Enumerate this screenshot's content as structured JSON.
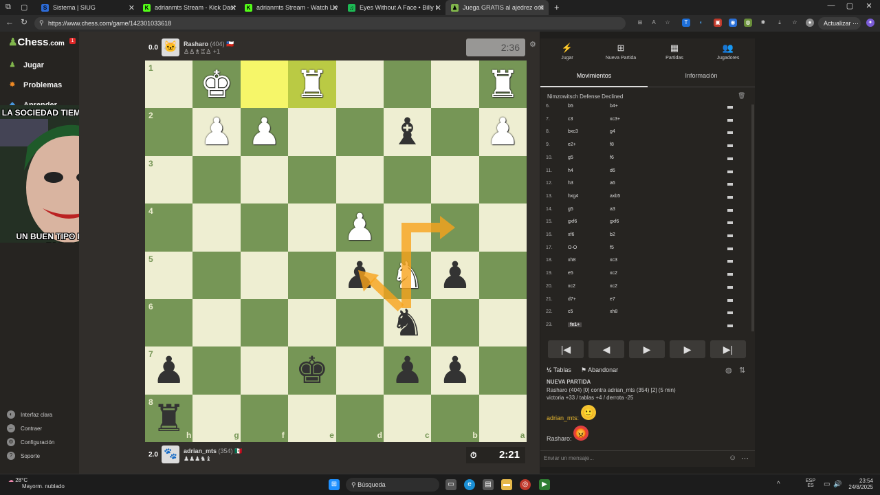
{
  "tabs": [
    {
      "label": "Sistema | SIUG",
      "icon": "siug-icon",
      "color": "#2d6bd6",
      "glyph": "S"
    },
    {
      "label": "adrianmts Stream - Kick Dashbo",
      "icon": "kick-icon",
      "color": "#53fc18",
      "glyph": "K"
    },
    {
      "label": "adrianmts Stream - Watch Live o",
      "icon": "kick-icon",
      "color": "#53fc18",
      "glyph": "K"
    },
    {
      "label": "Eyes Without A Face • Billy I",
      "icon": "spotify-icon",
      "color": "#1db954",
      "glyph": "♫"
    },
    {
      "label": "Juega GRATIS al ajedrez online -",
      "icon": "chess-icon",
      "color": "#81b64c",
      "glyph": "♟"
    }
  ],
  "address": {
    "url": "https://www.chess.com/game/142301033618",
    "update_label": "Actualizar"
  },
  "sidebar": {
    "brand": "Chess",
    "brand_suffix": ".com",
    "notif": "1",
    "items": [
      {
        "label": "Jugar"
      },
      {
        "label": "Problemas"
      },
      {
        "label": "Aprender"
      }
    ],
    "footer": [
      {
        "label": "Interfaz clara"
      },
      {
        "label": "Contraer"
      },
      {
        "label": "Configuración"
      },
      {
        "label": "Soporte"
      }
    ]
  },
  "meme": {
    "top": "LA SOCIEDAD TIEMBLA CUANDO",
    "bottom": "UN BUEN TIPO PIERDE LA PACIENCIA"
  },
  "players": {
    "top": {
      "name": "Rasharo",
      "rating": "(404)",
      "flag": "🇨🇱",
      "captured": "♙♙♗♖♙",
      "extra": "+1",
      "eval": "0.0",
      "clock": "2:36"
    },
    "bottom": {
      "name": "adrian_mts",
      "rating": "(354)",
      "flag": "🇲🇽",
      "captured": "♟♟♟♞♝",
      "eval": "2.0",
      "clock": "2:21"
    }
  },
  "board": {
    "ranks": [
      "1",
      "2",
      "3",
      "4",
      "5",
      "6",
      "7",
      "8"
    ],
    "files": [
      "h",
      "g",
      "f",
      "e",
      "d",
      "c",
      "b",
      "a"
    ],
    "squares": [
      [
        "",
        "K",
        "",
        "R",
        "",
        "",
        "",
        "R"
      ],
      [
        "",
        "P",
        "P",
        "",
        "",
        "b",
        "",
        "P"
      ],
      [
        "",
        "",
        "",
        "",
        "",
        "",
        "",
        ""
      ],
      [
        "",
        "",
        "",
        "",
        "P",
        "",
        "",
        ""
      ],
      [
        "",
        "",
        "",
        "",
        "p",
        "N",
        "p",
        ""
      ],
      [
        "",
        "",
        "",
        "",
        "",
        "n",
        "",
        ""
      ],
      [
        "p",
        "",
        "",
        "k",
        "",
        "p",
        "p",
        ""
      ],
      [
        "r",
        "",
        "",
        "",
        "",
        "",
        "",
        ""
      ]
    ],
    "highlight": [
      [
        0,
        2
      ],
      [
        0,
        3
      ]
    ]
  },
  "right_tabs": [
    {
      "label": "Jugar"
    },
    {
      "label": "Nueva Partida"
    },
    {
      "label": "Partidas"
    },
    {
      "label": "Jugadores"
    }
  ],
  "subtabs": {
    "moves": "Movimientos",
    "info": "Información"
  },
  "opening": "Nimzowitsch Defense Declined",
  "moves": [
    {
      "n": "6.",
      "w": "b5",
      "b": "b4+"
    },
    {
      "n": "7.",
      "w": "c3",
      "b": "xc3+"
    },
    {
      "n": "8.",
      "w": "bxc3",
      "b": "g4"
    },
    {
      "n": "9.",
      "w": "e2+",
      "b": "f8"
    },
    {
      "n": "10.",
      "w": "g5",
      "b": "f6"
    },
    {
      "n": "11.",
      "w": "h4",
      "b": "d6"
    },
    {
      "n": "12.",
      "w": "h3",
      "b": "a6"
    },
    {
      "n": "13.",
      "w": "hxg4",
      "b": "axb5"
    },
    {
      "n": "14.",
      "w": "g5",
      "b": "a3"
    },
    {
      "n": "15.",
      "w": "gxf6",
      "b": "gxf6"
    },
    {
      "n": "16.",
      "w": "xf6",
      "b": "b2"
    },
    {
      "n": "17.",
      "w": "O-O",
      "b": "f5"
    },
    {
      "n": "18.",
      "w": "xh8",
      "b": "xc3"
    },
    {
      "n": "19.",
      "w": "e5",
      "b": "xc2"
    },
    {
      "n": "20.",
      "w": "xc2",
      "b": "xc2"
    },
    {
      "n": "21.",
      "w": "d7+",
      "b": "e7"
    },
    {
      "n": "22.",
      "w": "c5",
      "b": "xh8"
    },
    {
      "n": "23.",
      "w": "fe1+",
      "b": ""
    }
  ],
  "actions": {
    "draw": "Tablas",
    "resign": "Abandonar"
  },
  "game_info": {
    "title": "NUEVA PARTIDA",
    "line1": "Rasharo (404) [0] contra adrian_mts (354) [2] (5 min)",
    "line2": "victoria +33 / tablas +4 / derrota -25"
  },
  "chat": [
    {
      "user": "adrian_mts:",
      "emoji": "🙂"
    },
    {
      "user": "Rasharo:",
      "emoji": "😡"
    }
  ],
  "chat_placeholder": "Enviar un mensaje...",
  "weather": {
    "temp": "28°C",
    "desc": "Mayorm. nublado"
  },
  "taskbar": {
    "search": "Búsqueda",
    "lang1": "ESP",
    "lang2": "ES",
    "time": "23:54",
    "date": "24/8/2025"
  }
}
